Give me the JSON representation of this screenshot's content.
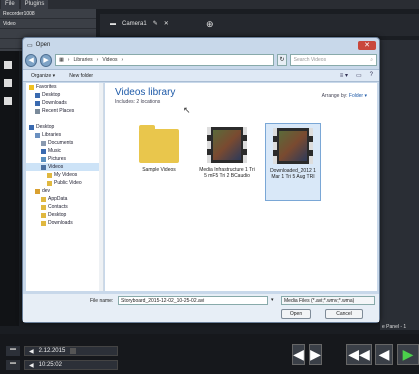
{
  "app": {
    "menu": [
      "File",
      "Plugins"
    ],
    "side_rows": [
      "Recorder1008",
      "Video",
      "",
      ""
    ],
    "tab": {
      "label": "Camera1",
      "plus": "⊕"
    },
    "panel_name": "e Panel - 1",
    "date": "2.12.2015",
    "time": "10:25:02",
    "nav": {
      "frame_back": "◀",
      "frame_fwd": "▶",
      "rewind": "◀◀",
      "back": "◀",
      "play": "▶"
    }
  },
  "dialog": {
    "title": "Open",
    "close": "✕",
    "breadcrumb": [
      "Libraries",
      "Videos"
    ],
    "search_placeholder": "Search Videos",
    "toolbar": {
      "organize": "Organize ▾",
      "new_folder": "New folder",
      "view": "≡ ▾",
      "help": "?"
    },
    "nav_items": [
      {
        "label": "Favorites",
        "icon": "star-icon",
        "indent": 0
      },
      {
        "label": "Desktop",
        "icon": "desktop-icon",
        "indent": 1
      },
      {
        "label": "Downloads",
        "icon": "downloads-icon",
        "indent": 1
      },
      {
        "label": "Recent Places",
        "icon": "recent-places-icon",
        "indent": 1
      },
      {
        "label": "",
        "icon": "",
        "indent": 0
      },
      {
        "label": "Desktop",
        "icon": "desktop-icon",
        "indent": 0
      },
      {
        "label": "Libraries",
        "icon": "libraries-icon",
        "indent": 1
      },
      {
        "label": "Documents",
        "icon": "documents-icon",
        "indent": 2
      },
      {
        "label": "Music",
        "icon": "music-icon",
        "indent": 2
      },
      {
        "label": "Pictures",
        "icon": "pictures-icon",
        "indent": 2
      },
      {
        "label": "Videos",
        "icon": "videos-icon",
        "indent": 2,
        "selected": true
      },
      {
        "label": "My Videos",
        "icon": "folder-icon",
        "indent": 3
      },
      {
        "label": "Public Video",
        "icon": "folder-icon",
        "indent": 3
      },
      {
        "label": "dev",
        "icon": "user-folder-icon",
        "indent": 1
      },
      {
        "label": "AppData",
        "icon": "folder-icon",
        "indent": 2
      },
      {
        "label": "Contacts",
        "icon": "folder-icon",
        "indent": 2
      },
      {
        "label": "Desktop",
        "icon": "folder-icon",
        "indent": 2
      },
      {
        "label": "Downloads",
        "icon": "folder-icon",
        "indent": 2
      }
    ],
    "library": {
      "title": "Videos library",
      "subtitle": "Includes: 2 locations",
      "arrange_label": "Arrange by:",
      "arrange_value": "Folder ▾"
    },
    "files": [
      {
        "name": "Sample Videos",
        "type": "folder"
      },
      {
        "name": "Media Infrastructure 1 Tri 5 mF5 Tri 2 BCaudio",
        "type": "video"
      },
      {
        "name": "Downloaded_2012 1 Mar 1 Tri 5 Aug TRI",
        "type": "video",
        "selected": true
      }
    ],
    "file_name_label": "File name:",
    "file_name_value": "Storyboard_2015-12-02_10-25-02.avi",
    "filter": "Media Files (*.avi;*.wmv;*.wma)",
    "open_button": "Open",
    "cancel_button": "Cancel"
  }
}
